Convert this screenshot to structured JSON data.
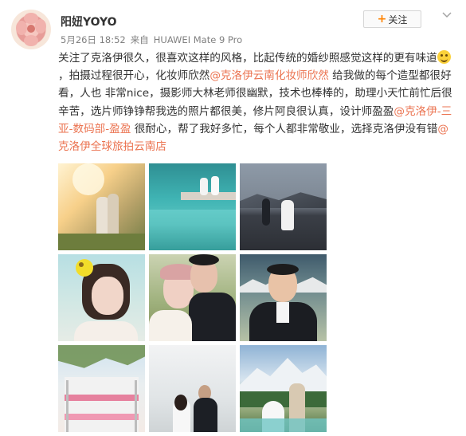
{
  "user": {
    "name": "阳妞YOYO"
  },
  "meta": {
    "date": "5月26日 18:52",
    "source_prefix": "来自",
    "device": "HUAWEI Mate 9 Pro"
  },
  "actions": {
    "follow_label": "关注",
    "follow_plus": "+"
  },
  "post": {
    "text_1": "关注了克洛伊很久，很喜欢这样的风格，比起传统的婚纱照感觉这样的更有味道",
    "text_2": "，拍摄过程很开心，化妆师欣然",
    "mention_1": "@克洛伊云南化妆师欣然",
    "text_3": " 给我做的每个造型都很好看，人也 非常nice，摄影师大林老师很幽默，技术也棒棒的，助理小天忙前忙后很辛苦，选片师铮铮帮我选的照片都很美，修片阿良很认真，设计师盈盈",
    "mention_2": "@克洛伊-三亚-数码部-盈盈",
    "text_4": " 很耐心，帮了我好多忙，每个人都非常敬业，选择克洛伊没有错",
    "mention_3": "@克洛伊全球旅拍云南店"
  },
  "photos": [
    "sunlit-garden-couple",
    "blue-lake-pier-couple",
    "road-mountain-couple",
    "bride-flower-crown",
    "couple-embrace-closeup",
    "groom-bowtie-portrait",
    "flower-balcony",
    "couple-window-light",
    "snow-mountain-couple"
  ],
  "colors": {
    "mention": "#eb7350",
    "follow_plus": "#ff8200",
    "meta": "#808080"
  }
}
